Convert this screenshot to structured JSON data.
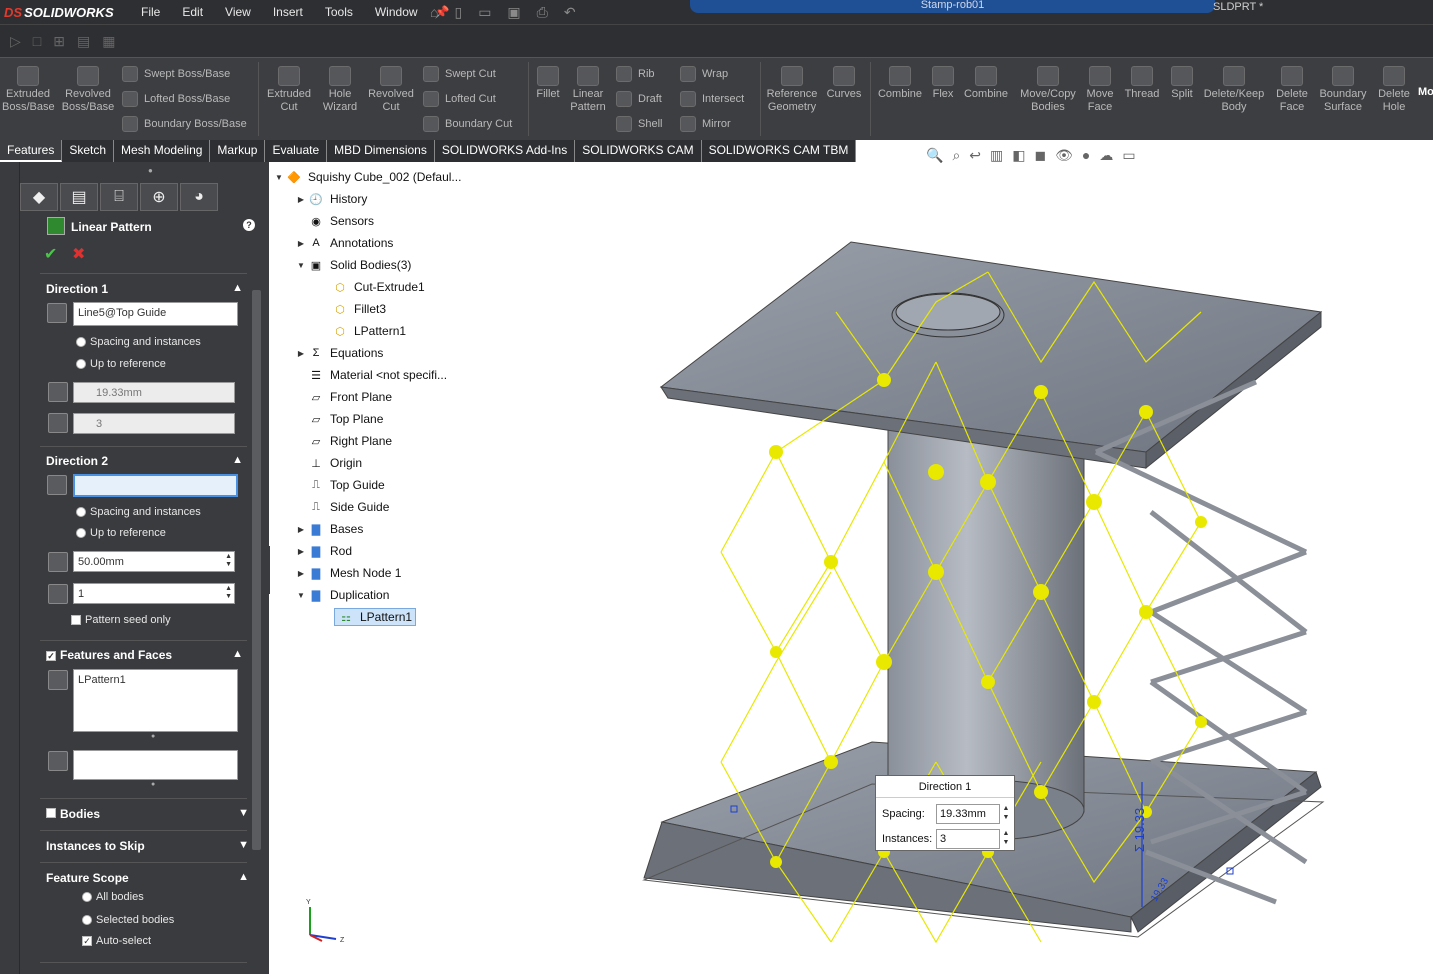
{
  "app": {
    "logo_ds": "DS",
    "logo_name": "SOLIDWORKS",
    "doc_title": "Stamp-rob01",
    "file_suffix": "SLDPRT *"
  },
  "menu": {
    "file": "File",
    "edit": "Edit",
    "view": "View",
    "insert": "Insert",
    "tools": "Tools",
    "window": "Window"
  },
  "ribbon": {
    "extruded_boss": "Extruded Boss/Base",
    "revolved_boss": "Revolved Boss/Base",
    "swept_boss": "Swept Boss/Base",
    "lofted_boss": "Lofted Boss/Base",
    "boundary_boss": "Boundary Boss/Base",
    "extruded_cut": "Extruded Cut",
    "hole_wizard": "Hole Wizard",
    "revolved_cut": "Revolved Cut",
    "swept_cut": "Swept Cut",
    "lofted_cut": "Lofted Cut",
    "boundary_cut": "Boundary Cut",
    "fillet": "Fillet",
    "linear_pattern": "Linear Pattern",
    "rib": "Rib",
    "draft": "Draft",
    "shell": "Shell",
    "wrap": "Wrap",
    "intersect": "Intersect",
    "mirror": "Mirror",
    "reference_geometry": "Reference Geometry",
    "curves": "Curves",
    "combine1": "Combine",
    "flex": "Flex",
    "combine2": "Combine",
    "move_copy": "Move/Copy Bodies",
    "move_face": "Move Face",
    "thread": "Thread",
    "split": "Split",
    "delete_keep": "Delete/Keep Body",
    "delete_face": "Delete Face",
    "boundary_surface": "Boundary Surface",
    "delete_hole": "Delete Hole",
    "more": "Mo"
  },
  "tabs": [
    "Features",
    "Sketch",
    "Mesh Modeling",
    "Markup",
    "Evaluate",
    "MBD Dimensions",
    "SOLIDWORKS Add-Ins",
    "SOLIDWORKS CAM",
    "SOLIDWORKS CAM TBM"
  ],
  "pm": {
    "title": "Linear Pattern",
    "help": "?",
    "ok": "✔",
    "cancel": "✖",
    "dir1": {
      "header": "Direction 1",
      "edge": "Line5@Top Guide",
      "opt_spacing": "Spacing and instances",
      "opt_upto": "Up to reference",
      "spacing": "19.33mm",
      "instances": "3"
    },
    "dir2": {
      "header": "Direction 2",
      "edge": "",
      "opt_spacing": "Spacing and instances",
      "opt_upto": "Up to reference",
      "spacing": "50.00mm",
      "instances": "1",
      "seed_only": "Pattern seed only"
    },
    "ff": {
      "header": "Features and Faces",
      "item": "LPattern1"
    },
    "bodies": "Bodies",
    "skip": "Instances to Skip",
    "scope": {
      "header": "Feature Scope",
      "all": "All bodies",
      "selected": "Selected bodies",
      "auto": "Auto-select"
    }
  },
  "tree": {
    "root": "Squishy Cube_002  (Defaul...",
    "items": [
      "History",
      "Sensors",
      "Annotations",
      "Solid Bodies(3)",
      "Cut-Extrude1",
      "Fillet3",
      "LPattern1",
      "Equations",
      "Material <not specifi...",
      "Front Plane",
      "Top Plane",
      "Right Plane",
      "Origin",
      "Top Guide",
      "Side Guide",
      "Bases",
      "Rod",
      "Mesh Node 1",
      "Duplication",
      "LPattern1"
    ]
  },
  "popup": {
    "title": "Direction 1",
    "spacing_label": "Spacing:",
    "spacing": "19.33mm",
    "instances_label": "Instances:",
    "instances": "3"
  },
  "dim": {
    "value": "Σ 19.33",
    "small": "19.33"
  },
  "triad": {
    "x": "X",
    "y": "Y",
    "z": "Z"
  },
  "colors": {
    "accent": "#1f4f95",
    "highlight": "#ffff00",
    "model": "#7f8590"
  }
}
